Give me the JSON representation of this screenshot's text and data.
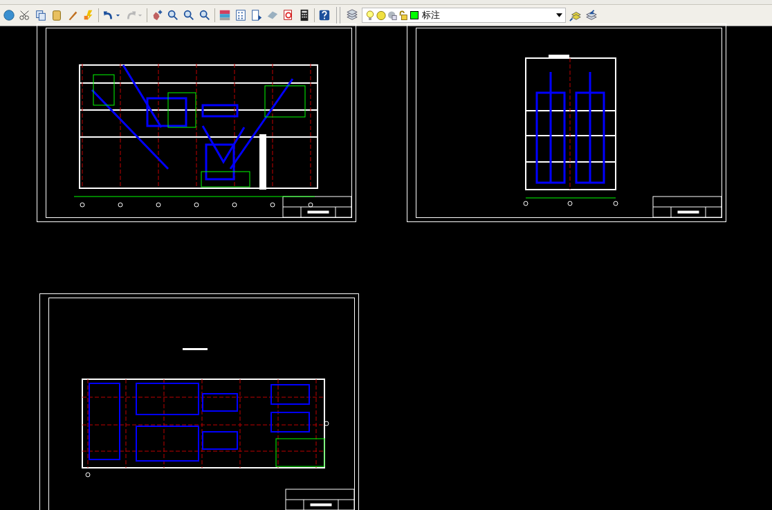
{
  "toolbar": {
    "buttons": [
      {
        "kind": "undo",
        "disabled": false
      },
      {
        "kind": "redo",
        "disabled": true
      }
    ]
  },
  "layer_control": {
    "layer_name": "标注",
    "color": "#00ff00"
  }
}
